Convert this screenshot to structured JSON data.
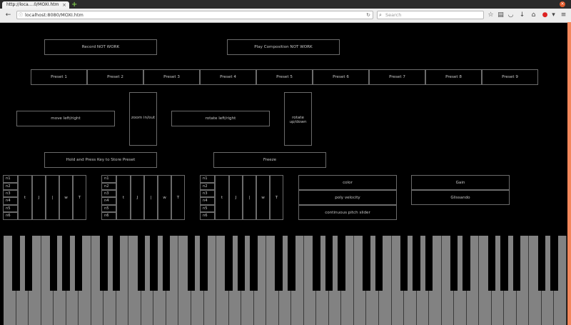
{
  "browser": {
    "tab_title": "http://loca....0/MOXI.htm",
    "tab_close": "×",
    "new_tab": "+",
    "url": "localhost:8080/MOXI.htm",
    "search_placeholder": "Search"
  },
  "top_buttons": {
    "record": "Record NOT WORK",
    "play": "Play Composition NOT WORK"
  },
  "presets": [
    "Preset 1",
    "Preset 2",
    "Preset 3",
    "Preset 4",
    "Preset 5",
    "Preset 6",
    "Preset 7",
    "Preset 8",
    "Preset 9"
  ],
  "controls": {
    "move": "move left/right",
    "zoom": "zoom in/out",
    "rotate_lr": "rotate left/right",
    "rotate_ud": "rotate up/down",
    "hold_store": "Hold and Press Key to Store Preset",
    "freeze": "Freeze"
  },
  "voice_groups": [
    {
      "rows": [
        "n1",
        "n2",
        "n3",
        "n4",
        "n5",
        "n6"
      ],
      "cols": [
        "t",
        "J",
        "|",
        "w",
        "T"
      ]
    },
    {
      "rows": [
        "n1",
        "n2",
        "n3",
        "n4",
        "n5",
        "n6"
      ],
      "cols": [
        "t",
        "J",
        "|",
        "w",
        "T"
      ]
    },
    {
      "rows": [
        "n1",
        "n2",
        "n3",
        "n4",
        "n5",
        "n6"
      ],
      "cols": [
        "t",
        "J",
        "|",
        "w",
        "T"
      ]
    }
  ],
  "options": {
    "color": "color",
    "poly_velocity": "poly velocity",
    "pitch_slider": "continuous pitch slider",
    "gain": "Gain",
    "glissando": "Glissando"
  },
  "keyboard": {
    "white_keys": 45,
    "black_pattern": [
      1,
      1,
      0,
      1,
      1,
      1,
      0
    ]
  }
}
